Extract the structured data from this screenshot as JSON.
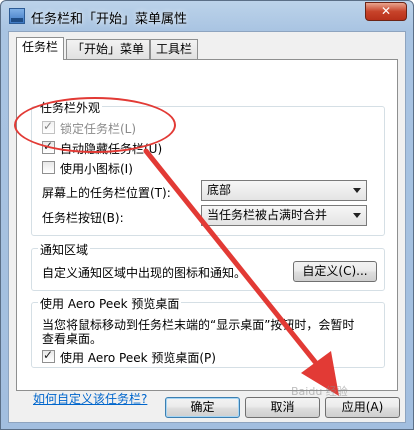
{
  "window": {
    "title": "任务栏和「开始」菜单属性",
    "close_label": "✕"
  },
  "tabs": [
    {
      "label": "任务栏",
      "active": true
    },
    {
      "label": "「开始」菜单",
      "active": false
    },
    {
      "label": "工具栏",
      "active": false
    }
  ],
  "appearance": {
    "title": "任务栏外观",
    "lock_label": "锁定任务栏(L)",
    "lock_checked": true,
    "autohide_label": "自动隐藏任务栏(U)",
    "autohide_checked": true,
    "small_icons_label": "使用小图标(I)",
    "small_icons_checked": false,
    "location_label": "屏幕上的任务栏位置(T):",
    "location_value": "底部",
    "buttons_label": "任务栏按钮(B):",
    "buttons_value": "当任务栏被占满时合并"
  },
  "notification": {
    "title": "通知区域",
    "description": "自定义通知区域中出现的图标和通知。",
    "customize_button": "自定义(C)..."
  },
  "peek": {
    "title": "使用 Aero Peek 预览桌面",
    "description_line1": "当您将鼠标移动到任务栏末端的“显示桌面”按钮时，会暂时",
    "description_line2": "查看桌面。",
    "checkbox_label": "使用 Aero Peek 预览桌面(P)",
    "checked": true
  },
  "help_link": "如何自定义该任务栏?",
  "footer": {
    "ok": "确定",
    "cancel": "取消",
    "apply": "应用(A)"
  },
  "annotation": {
    "color": "#e23a35"
  },
  "watermark": "Baidu 经验"
}
